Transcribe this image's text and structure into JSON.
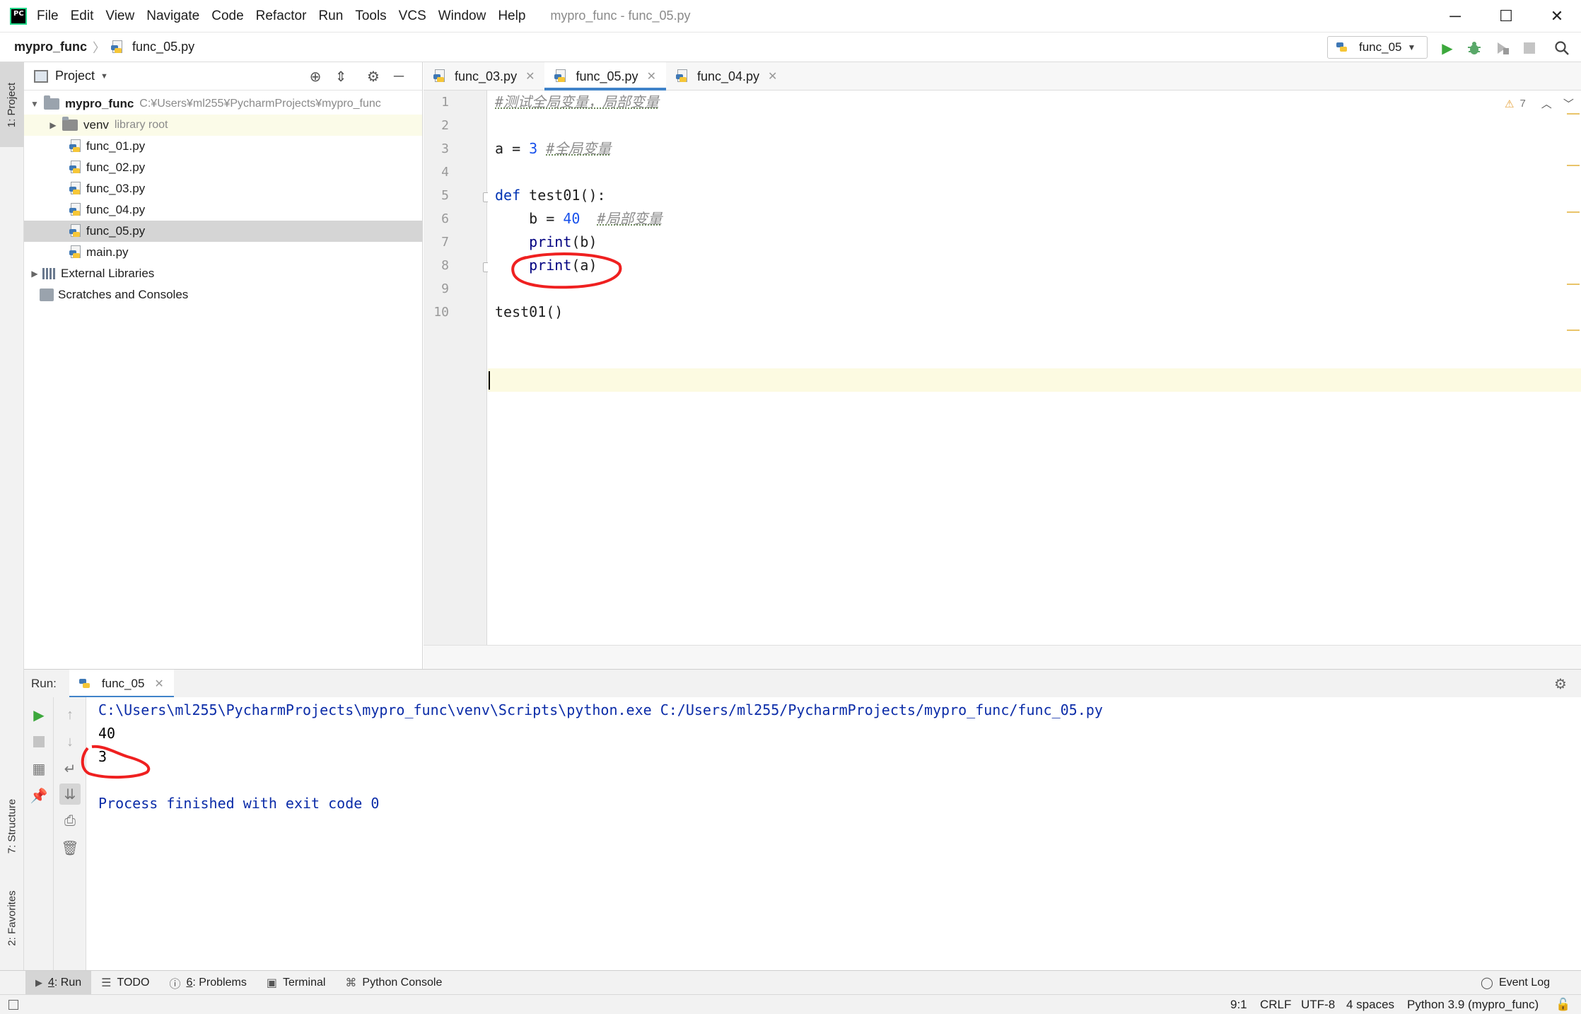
{
  "menu": [
    "File",
    "Edit",
    "View",
    "Navigate",
    "Code",
    "Refactor",
    "Run",
    "Tools",
    "VCS",
    "Window",
    "Help"
  ],
  "window_title": "mypro_func - func_05.py",
  "breadcrumb": {
    "project": "mypro_func",
    "file": "func_05.py"
  },
  "run_config": {
    "name": "func_05"
  },
  "left_strip": {
    "project": "1: Project",
    "structure": "7: Structure",
    "favorites": "2: Favorites"
  },
  "project_panel": {
    "title": "Project",
    "root": {
      "name": "mypro_func",
      "path": "C:¥Users¥ml255¥PycharmProjects¥mypro_func"
    },
    "venv": {
      "name": "venv",
      "note": "library root"
    },
    "files": [
      "func_01.py",
      "func_02.py",
      "func_03.py",
      "func_04.py",
      "func_05.py",
      "main.py"
    ],
    "selected_file": "func_05.py",
    "external": "External Libraries",
    "scratches": "Scratches and Consoles"
  },
  "editor": {
    "tabs": [
      "func_03.py",
      "func_05.py",
      "func_04.py"
    ],
    "active_tab": "func_05.py",
    "warning_count": "7",
    "line_numbers": [
      "1",
      "2",
      "3",
      "4",
      "5",
      "6",
      "7",
      "8",
      "9",
      "10"
    ],
    "code": {
      "l1_comment": "#测试全局变量，局部变量",
      "l3_var": "a = ",
      "l3_num": "3",
      "l3_comment": "#全局变量",
      "l5_def": "def",
      "l5_name": " test01():",
      "l6_var": "    b = ",
      "l6_num": "40",
      "l6_comment": "#局部变量",
      "l7_fn": "print",
      "l7_arg": "(b)",
      "l8_fn": "print",
      "l8_arg": "(a)",
      "l10": "test01()"
    },
    "current_line": 9
  },
  "run_panel": {
    "label": "Run:",
    "tab": "func_05",
    "console": {
      "command": "C:\\Users\\ml255\\PycharmProjects\\mypro_func\\venv\\Scripts\\python.exe C:/Users/ml255/PycharmProjects/mypro_func/func_05.py",
      "out1": "40",
      "out2": "3",
      "finished": "Process finished with exit code 0"
    }
  },
  "tool_windows": [
    {
      "num": "4",
      "label": ": Run"
    },
    {
      "num": "",
      "label": "TODO"
    },
    {
      "num": "6",
      "label": ": Problems"
    },
    {
      "num": "",
      "label": "Terminal"
    },
    {
      "num": "",
      "label": "Python Console"
    }
  ],
  "event_log": "Event Log",
  "status": {
    "position": "9:1",
    "line_sep": "CRLF",
    "encoding": "UTF-8",
    "indent": "4 spaces",
    "interpreter": "Python 3.9 (mypro_func)"
  },
  "colors": {
    "keyword": "#0033b3",
    "number": "#1750eb",
    "comment": "#8c8c8c",
    "console_blue": "#0b2ca8",
    "annotation_red": "#ef2020",
    "accent": "#4083c9"
  }
}
